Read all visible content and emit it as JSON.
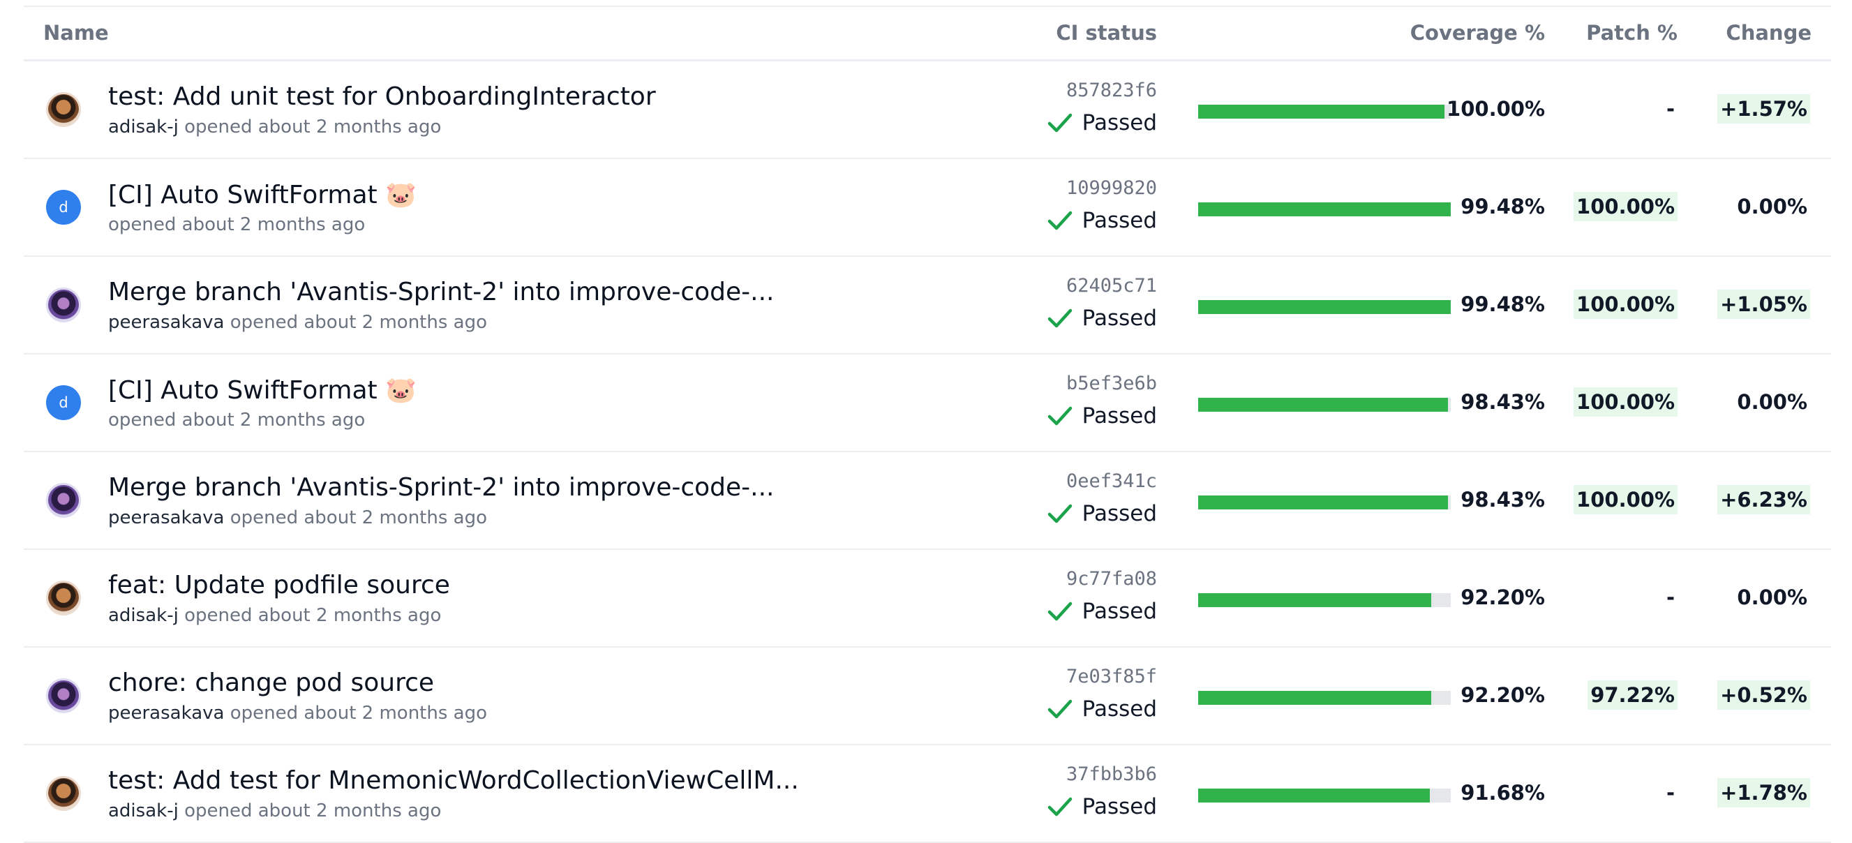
{
  "columns": {
    "name": "Name",
    "ci_status": "CI status",
    "coverage": "Coverage %",
    "patch": "Patch %",
    "change": "Change"
  },
  "colors": {
    "bar_fill": "#2fb34a",
    "passed_check": "#1aa34a",
    "positive_highlight": "#e5f8ea",
    "initial_avatar": "#2f80ed"
  },
  "rows": [
    {
      "title": "test: Add unit test for OnboardingInteractor",
      "author": "adisak-j",
      "opened": "opened about 2 months ago",
      "avatar": "photo-a",
      "avatar_initial": "",
      "sha": "857823f6",
      "ci_status": "Passed",
      "coverage": "100.00%",
      "coverage_fraction": 0.975,
      "patch": "-",
      "patch_highlight": false,
      "change": "+1.57%",
      "change_highlight": true
    },
    {
      "title": "[CI] Auto SwiftFormat 🐷",
      "author": "",
      "opened": "opened about 2 months ago",
      "avatar": "initial",
      "avatar_initial": "d",
      "sha": "10999820",
      "ci_status": "Passed",
      "coverage": "99.48%",
      "coverage_fraction": 1.0,
      "patch": "100.00%",
      "patch_highlight": true,
      "change": "0.00%",
      "change_highlight": false
    },
    {
      "title": "Merge branch 'Avantis-Sprint-2' into improve-code-...",
      "author": "peerasakava",
      "opened": "opened about 2 months ago",
      "avatar": "photo-b",
      "avatar_initial": "",
      "sha": "62405c71",
      "ci_status": "Passed",
      "coverage": "99.48%",
      "coverage_fraction": 1.0,
      "patch": "100.00%",
      "patch_highlight": true,
      "change": "+1.05%",
      "change_highlight": true
    },
    {
      "title": "[CI] Auto SwiftFormat 🐷",
      "author": "",
      "opened": "opened about 2 months ago",
      "avatar": "initial",
      "avatar_initial": "d",
      "sha": "b5ef3e6b",
      "ci_status": "Passed",
      "coverage": "98.43%",
      "coverage_fraction": 0.99,
      "patch": "100.00%",
      "patch_highlight": true,
      "change": "0.00%",
      "change_highlight": false
    },
    {
      "title": "Merge branch 'Avantis-Sprint-2' into improve-code-...",
      "author": "peerasakava",
      "opened": "opened about 2 months ago",
      "avatar": "photo-b",
      "avatar_initial": "",
      "sha": "0eef341c",
      "ci_status": "Passed",
      "coverage": "98.43%",
      "coverage_fraction": 0.99,
      "patch": "100.00%",
      "patch_highlight": true,
      "change": "+6.23%",
      "change_highlight": true
    },
    {
      "title": "feat: Update podfile source",
      "author": "adisak-j",
      "opened": "opened about 2 months ago",
      "avatar": "photo-a",
      "avatar_initial": "",
      "sha": "9c77fa08",
      "ci_status": "Passed",
      "coverage": "92.20%",
      "coverage_fraction": 0.922,
      "patch": "-",
      "patch_highlight": false,
      "change": "0.00%",
      "change_highlight": false
    },
    {
      "title": "chore: change pod source",
      "author": "peerasakava",
      "opened": "opened about 2 months ago",
      "avatar": "photo-b",
      "avatar_initial": "",
      "sha": "7e03f85f",
      "ci_status": "Passed",
      "coverage": "92.20%",
      "coverage_fraction": 0.922,
      "patch": "97.22%",
      "patch_highlight": true,
      "change": "+0.52%",
      "change_highlight": true
    },
    {
      "title": "test: Add test for MnemonicWordCollectionViewCellM...",
      "author": "adisak-j",
      "opened": "opened about 2 months ago",
      "avatar": "photo-a",
      "avatar_initial": "",
      "sha": "37fbb3b6",
      "ci_status": "Passed",
      "coverage": "91.68%",
      "coverage_fraction": 0.917,
      "patch": "-",
      "patch_highlight": false,
      "change": "+1.78%",
      "change_highlight": true
    }
  ]
}
